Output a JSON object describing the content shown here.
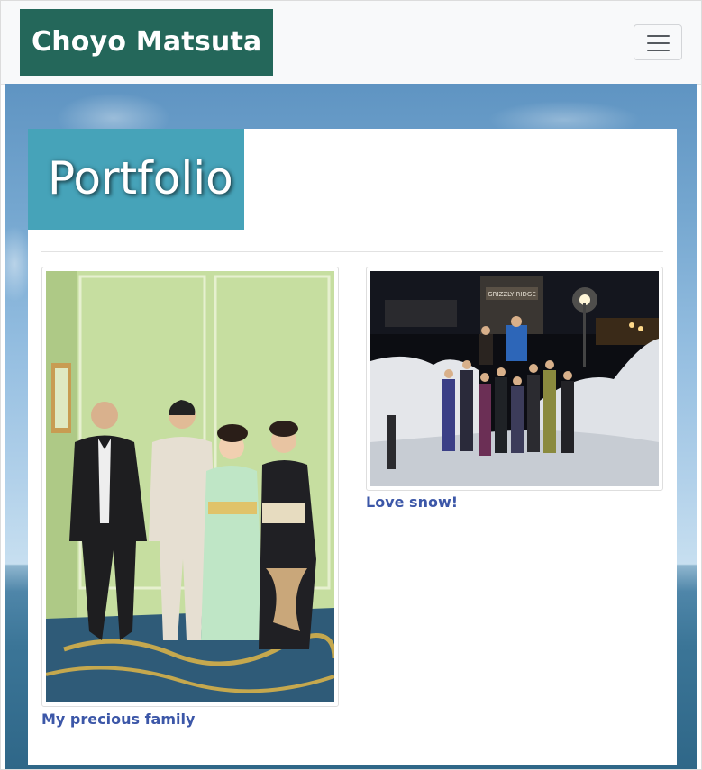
{
  "navbar": {
    "brand": "Choyo Matsuta",
    "toggler_icon": "hamburger-menu-icon"
  },
  "page": {
    "title": "Portfolio"
  },
  "portfolio": {
    "items": [
      {
        "caption": "My precious family",
        "image": "family-photo"
      },
      {
        "caption": "Love snow!",
        "image": "snow-group-photo"
      }
    ],
    "snow_photo_sign": "GRIZZLY RIDGE"
  },
  "colors": {
    "brand_bg": "#24675a",
    "title_bg": "#46a3b9",
    "caption": "#3c57a8",
    "navbar_bg": "#f8f9fa"
  }
}
